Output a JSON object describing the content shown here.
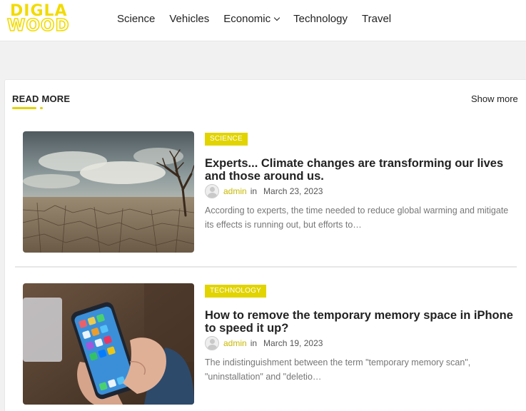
{
  "logo": {
    "line1": "DIGLA",
    "line2": "WOOD"
  },
  "nav": {
    "items": [
      {
        "label": "Science"
      },
      {
        "label": "Vehicles"
      },
      {
        "label": "Economic",
        "has_dropdown": true
      },
      {
        "label": "Technology"
      },
      {
        "label": "Travel"
      }
    ]
  },
  "section": {
    "title": "READ MORE",
    "show_more": "Show more"
  },
  "posts": [
    {
      "category": "SCIENCE",
      "title": "Experts... Climate changes are transforming our lives and those around us.",
      "author": "admin",
      "in": "in",
      "date": "March 23, 2023",
      "excerpt": "According to experts, the time needed to reduce global warming and mitigate its effects is running out, but efforts to…"
    },
    {
      "category": "TECHNOLOGY",
      "title": "How to remove the temporary memory space in iPhone to speed it up?",
      "author": "admin",
      "in": "in",
      "date": "March 19, 2023",
      "excerpt": "The indistinguishment between the term \"temporary memory scan\", \"uninstallation\" and \"deletio…"
    }
  ],
  "colors": {
    "accent": "#e1d400",
    "author": "#c8b900",
    "text": "#222222",
    "muted": "#777777"
  },
  "icons": {
    "nav_dropdown": "chevron-down-icon",
    "author_avatar": "user-avatar-icon"
  }
}
